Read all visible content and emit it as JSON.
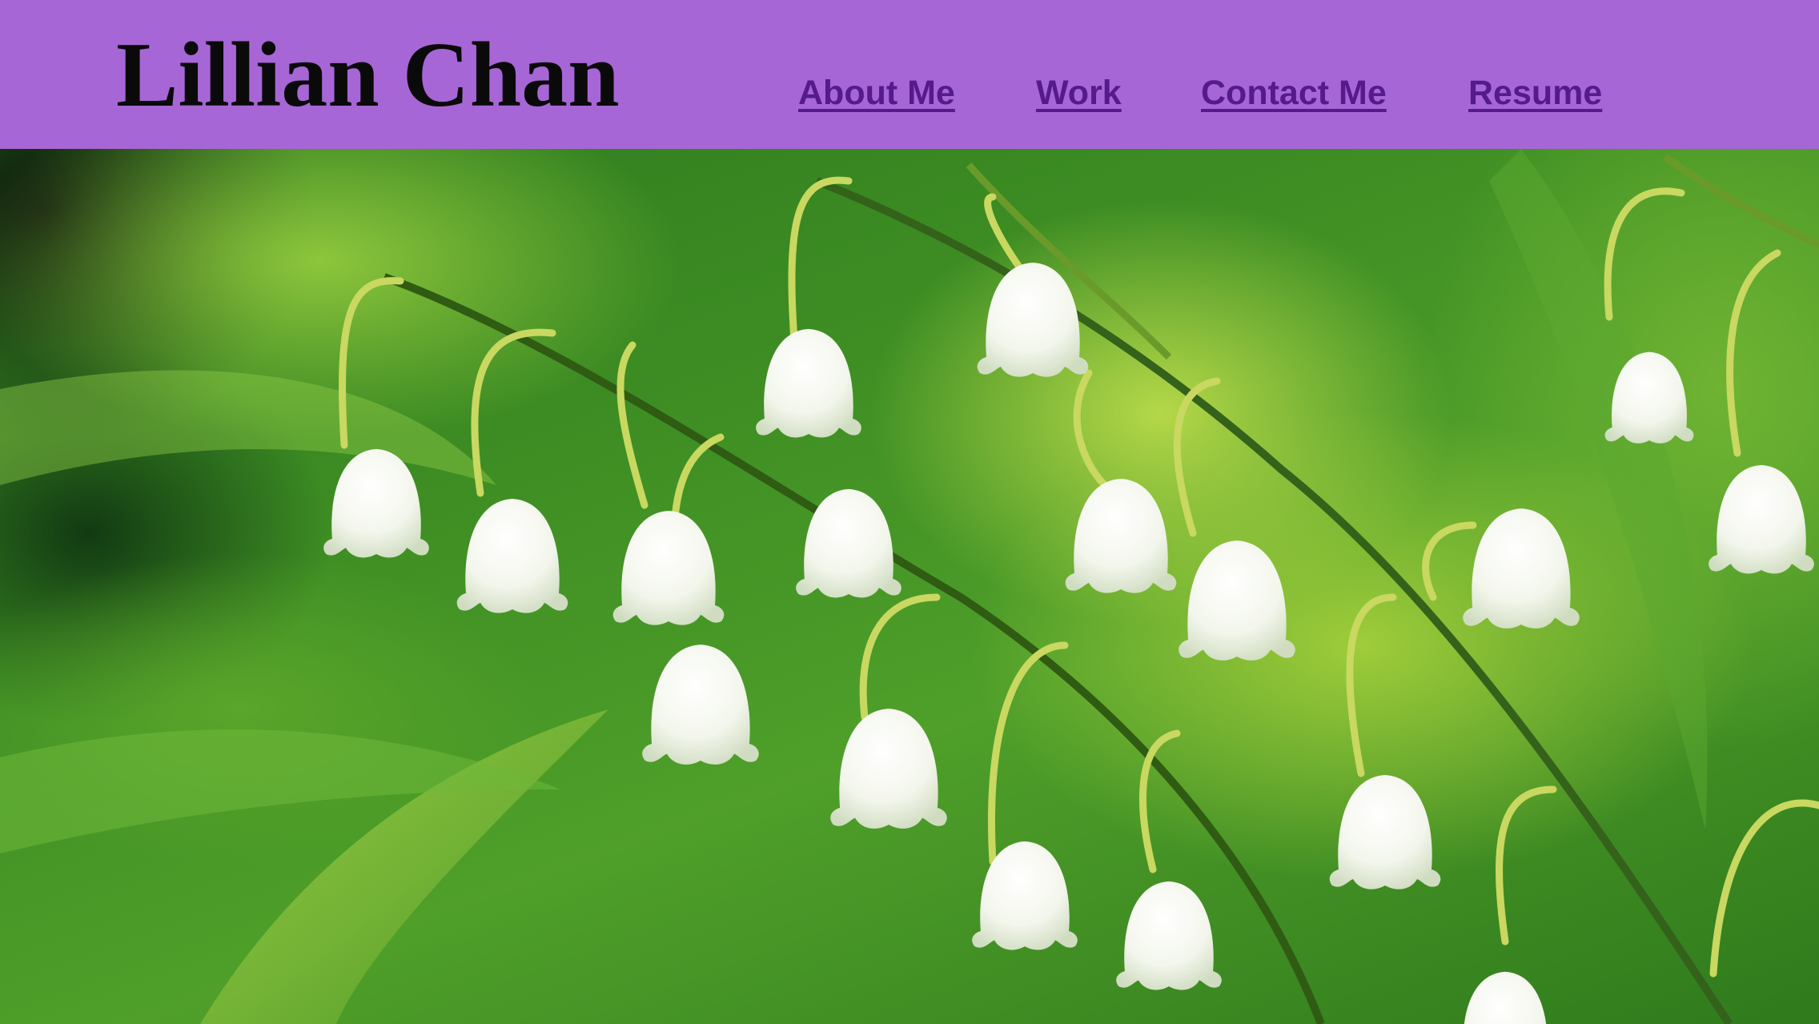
{
  "header": {
    "site_title": "Lillian Chan",
    "background_color": "#a766d6"
  },
  "nav": {
    "items": [
      {
        "label": "About Me"
      },
      {
        "label": "Work"
      },
      {
        "label": "Contact Me"
      },
      {
        "label": "Resume"
      }
    ],
    "link_color": "#551a8b"
  },
  "hero": {
    "image_subject": "lily-of-the-valley-flowers"
  }
}
